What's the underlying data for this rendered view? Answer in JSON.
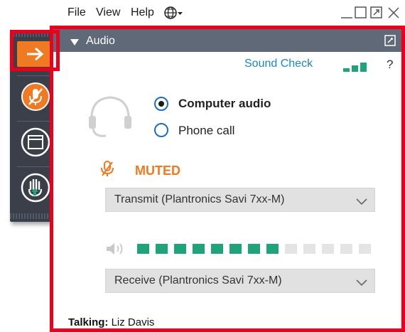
{
  "menu": {
    "file": "File",
    "view": "View",
    "help": "Help"
  },
  "toolbar": {
    "buttons": [
      "arrow-icon",
      "mic-muted-icon",
      "window-icon",
      "raise-hand-icon"
    ]
  },
  "panel": {
    "title": "Audio",
    "sound_check": "Sound Check",
    "help": "?",
    "audio_options": [
      {
        "label": "Computer audio",
        "selected": true
      },
      {
        "label": "Phone call",
        "selected": false
      }
    ],
    "mute_status": "MUTED",
    "transmit_device": "Transmit (Plantronics Savi 7xx-M)",
    "receive_device": "Receive (Plantronics Savi 7xx-M)",
    "speaker_level": {
      "active": 8,
      "total": 13
    },
    "talking_label": "Talking:",
    "talking_name": "Liz Davis"
  },
  "colors": {
    "accent_orange": "#f07a22",
    "link_blue": "#1a87c8",
    "level_green": "#1ea37a",
    "level_off": "#e4e4e4",
    "highlight_red": "#e8001c"
  }
}
